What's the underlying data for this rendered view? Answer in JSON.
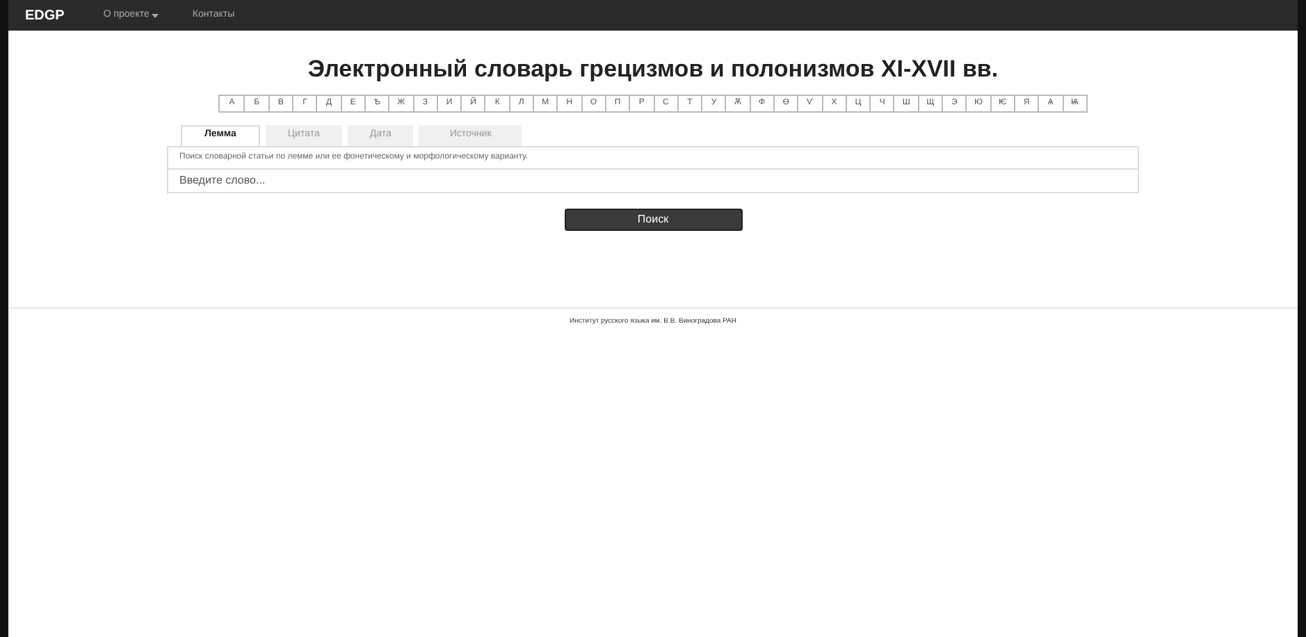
{
  "navbar": {
    "brand": "EDGP",
    "items": [
      {
        "label": "О проекте",
        "dropdown": true
      },
      {
        "label": "Контакты",
        "dropdown": false
      }
    ]
  },
  "title": "Электронный словарь грецизмов и полонизмов XI-XVII вв.",
  "alphabet": [
    "А",
    "Б",
    "В",
    "Г",
    "Д",
    "Е",
    "Ѣ",
    "Ж",
    "З",
    "И",
    "Й",
    "К",
    "Л",
    "М",
    "Н",
    "О",
    "П",
    "Р",
    "С",
    "Т",
    "У",
    "Ѫ",
    "Ф",
    "Ѳ",
    "Ѵ",
    "Х",
    "Ц",
    "Ч",
    "Ш",
    "Щ",
    "Э",
    "Ю",
    "Ѥ",
    "Я",
    "Ѧ",
    "Ѩ"
  ],
  "tabs": [
    {
      "label": "Лемма",
      "selected": true
    },
    {
      "label": "Цитата",
      "selected": false
    },
    {
      "label": "Дата",
      "selected": false
    },
    {
      "label": "Источник",
      "selected": false
    }
  ],
  "description": "Поиск словарной статьи по лемме или ее фонетическому и морфологическому варианту.",
  "search": {
    "placeholder": "Введите слово..."
  },
  "search_button": "Поиск",
  "footer": "Институт русского языка им. В.В. Виноградова РАН"
}
